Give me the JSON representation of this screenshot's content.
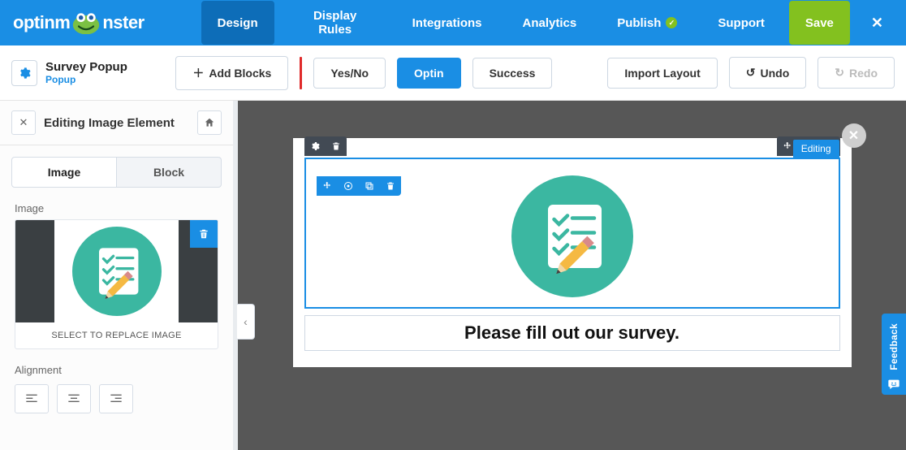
{
  "brand": {
    "name_pre": "optinm",
    "name_post": "nster"
  },
  "nav": {
    "design": "Design",
    "display_rules": "Display Rules",
    "integrations": "Integrations",
    "analytics": "Analytics",
    "publish": "Publish",
    "support": "Support",
    "save": "Save"
  },
  "campaign": {
    "title": "Survey Popup",
    "type": "Popup"
  },
  "toolbar": {
    "add_blocks": "Add Blocks",
    "yes_no": "Yes/No",
    "optin": "Optin",
    "success": "Success",
    "import_layout": "Import Layout",
    "undo": "Undo",
    "redo": "Redo"
  },
  "sidebar": {
    "title": "Editing Image Element",
    "tabs": {
      "image": "Image",
      "block": "Block"
    },
    "image_section_label": "Image",
    "picker_caption": "SELECT TO REPLACE IMAGE",
    "alignment_label": "Alignment"
  },
  "canvas": {
    "headline": "Please fill out our survey.",
    "editing_badge": "Editing"
  },
  "feedback": {
    "label": "Feedback"
  }
}
